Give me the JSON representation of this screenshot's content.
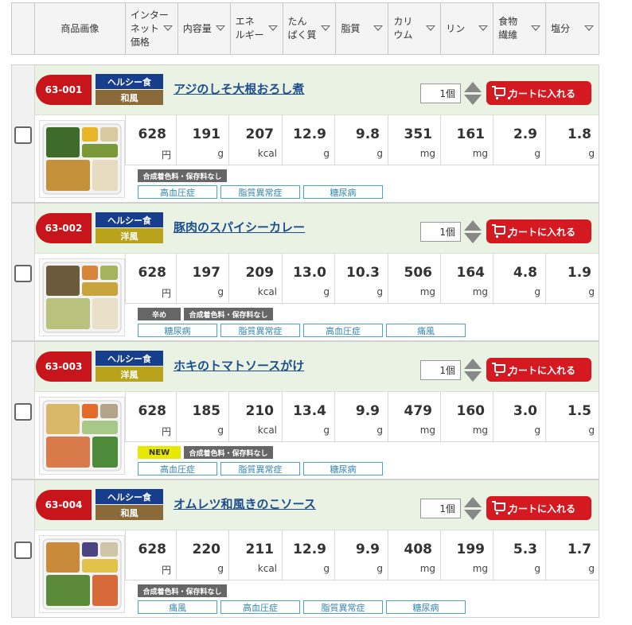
{
  "header": {
    "columns": [
      {
        "label": "商品画像"
      },
      {
        "label": "インター\nネット\n価格"
      },
      {
        "label": "内容量"
      },
      {
        "label": "エネ\nルギー"
      },
      {
        "label": "たん\nぱく質"
      },
      {
        "label": "脂質"
      },
      {
        "label": "カリ\nウム"
      },
      {
        "label": "リン"
      },
      {
        "label": "食物\n繊維"
      },
      {
        "label": "塩分"
      }
    ]
  },
  "units": {
    "price": "円",
    "weight": "g",
    "energy": "kcal",
    "protein": "g",
    "fat": "g",
    "potassium": "mg",
    "phosphorus": "mg",
    "fiber": "g",
    "salt": "g"
  },
  "cart_label": "カートに入れる",
  "items": [
    {
      "code": "63-001",
      "category": "ヘルシー食",
      "style": "和風",
      "style_color": "#8b6a3a",
      "name": "アジのしそ大根おろし煮",
      "qty": "1個",
      "price": "628",
      "weight": "191",
      "energy": "207",
      "protein": "12.9",
      "fat": "9.8",
      "potassium": "351",
      "phosphorus": "161",
      "fiber": "2.9",
      "salt": "1.8",
      "tags": [
        {
          "text": "合成着色料・保存料なし",
          "type": "dark"
        }
      ],
      "diseases": [
        "高血圧症",
        "脂質異常症",
        "糖尿病"
      ]
    },
    {
      "code": "63-002",
      "category": "ヘルシー食",
      "style": "洋風",
      "style_color": "#b9a31c",
      "name": "豚肉のスパイシーカレー",
      "qty": "1個",
      "price": "628",
      "weight": "197",
      "energy": "209",
      "protein": "13.0",
      "fat": "10.3",
      "potassium": "506",
      "phosphorus": "164",
      "fiber": "4.8",
      "salt": "1.9",
      "tags": [
        {
          "text": "辛め",
          "type": "dark"
        },
        {
          "text": "合成着色料・保存料なし",
          "type": "dark"
        }
      ],
      "diseases": [
        "糖尿病",
        "脂質異常症",
        "高血圧症",
        "痛風"
      ]
    },
    {
      "code": "63-003",
      "category": "ヘルシー食",
      "style": "洋風",
      "style_color": "#b9a31c",
      "name": "ホキのトマトソースがけ",
      "qty": "1個",
      "price": "628",
      "weight": "185",
      "energy": "210",
      "protein": "13.4",
      "fat": "9.9",
      "potassium": "479",
      "phosphorus": "160",
      "fiber": "3.0",
      "salt": "1.5",
      "tags": [
        {
          "text": "NEW",
          "type": "new"
        },
        {
          "text": "合成着色料・保存料なし",
          "type": "dark"
        }
      ],
      "diseases": [
        "高血圧症",
        "脂質異常症",
        "糖尿病"
      ]
    },
    {
      "code": "63-004",
      "category": "ヘルシー食",
      "style": "和風",
      "style_color": "#8b6a3a",
      "name": "オムレツ和風きのこソース",
      "qty": "1個",
      "price": "628",
      "weight": "220",
      "energy": "211",
      "protein": "12.9",
      "fat": "9.9",
      "potassium": "408",
      "phosphorus": "199",
      "fiber": "5.3",
      "salt": "1.7",
      "tags": [
        {
          "text": "合成着色料・保存料なし",
          "type": "dark"
        }
      ],
      "diseases": [
        "痛風",
        "高血圧症",
        "脂質異常症",
        "糖尿病"
      ]
    }
  ]
}
